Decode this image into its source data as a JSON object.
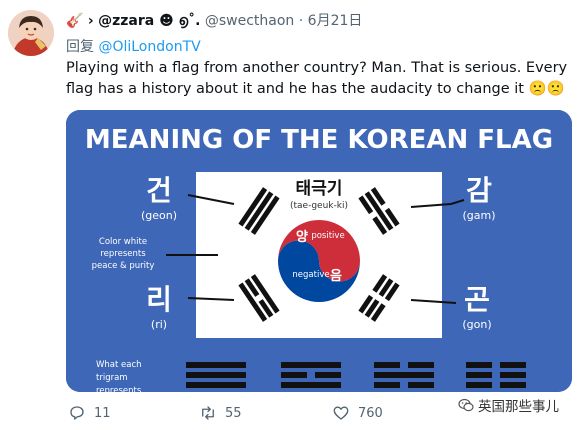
{
  "tweet": {
    "author_emoji": "🎸",
    "arrow": "›",
    "display_name": "@zzara ☻ ൭˚.",
    "handle": "@swecthaon",
    "separator": "·",
    "date": "6月21日",
    "reply_prefix": "回复",
    "reply_mention": "@OliLondonTV",
    "text": "Playing with a flag from another country? Man. That is serious. Every flag has a history about it and he has the audacity to change it 🙁🙁"
  },
  "infographic": {
    "title": "MEANING OF THE KOREAN FLAG",
    "center_korean": "태극기",
    "center_roman": "(tae-geuk-ki)",
    "yang_korean": "양",
    "yang_label": "positive",
    "eum_label": "negative",
    "eum_korean": "음",
    "geon_korean": "건",
    "geon_roman": "(geon)",
    "gam_korean": "감",
    "gam_roman": "(gam)",
    "ri_korean": "리",
    "ri_roman": "(ri)",
    "gon_korean": "곤",
    "gon_roman": "(gon)",
    "color_note_1": "Color white",
    "color_note_2": "represents",
    "color_note_3": "peace & purity",
    "trigram_note_1": "What each",
    "trigram_note_2": "trigram",
    "trigram_note_3": "represents",
    "colors": {
      "background": "#3e67b8",
      "red": "#cd2e3a",
      "blue": "#0047a0",
      "flag": "#ffffff"
    }
  },
  "actions": {
    "reply_count": "11",
    "retweet_count": "55",
    "like_count": "760"
  },
  "watermark": {
    "text": "英国那些事儿"
  }
}
